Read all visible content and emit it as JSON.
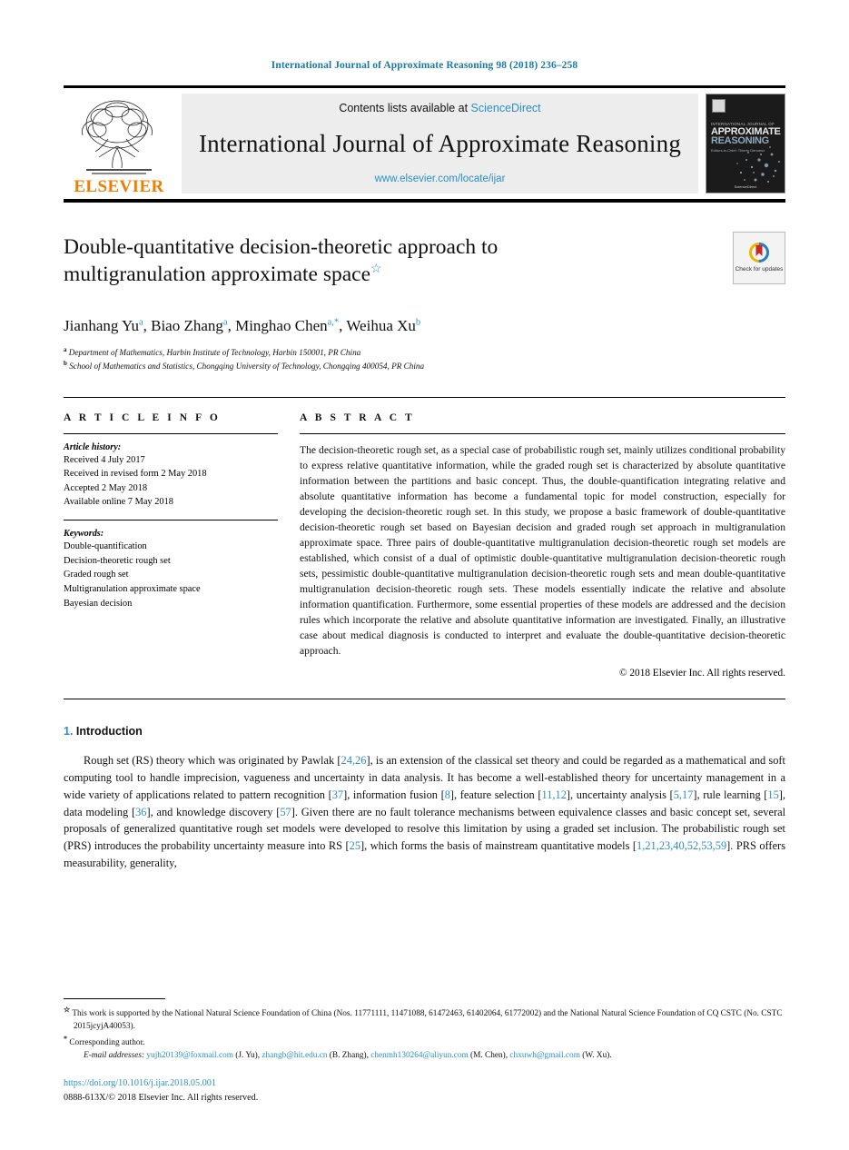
{
  "running_head": "International Journal of Approximate Reasoning 98 (2018) 236–258",
  "masthead": {
    "publisher_wordmark": "ELSEVIER",
    "contents_prefix": "Contents lists available at ",
    "contents_link": "ScienceDirect",
    "journal_title": "International Journal of Approximate Reasoning",
    "journal_url": "www.elsevier.com/locate/ijar",
    "cover": {
      "kicker": "INTERNATIONAL JOURNAL OF",
      "title_line1": "APPROXIMATE",
      "title_line2": "REASONING",
      "subtitle": "Editors-in-Chief: Thierry Denoeux",
      "footer": "ScienceDirect"
    }
  },
  "article": {
    "title": "Double-quantitative decision-theoretic approach to multigranulation approximate space",
    "title_line1": "Double-quantitative decision-theoretic approach to",
    "title_line2": "multigranulation approximate space",
    "title_footnote_mark": "☆",
    "crossmark_label": "Check for updates",
    "authors": [
      {
        "name": "Jianhang Yu",
        "marks": "a",
        "sep": ", "
      },
      {
        "name": "Biao Zhang",
        "marks": "a",
        "sep": ", "
      },
      {
        "name": "Minghao Chen",
        "marks": "a,*",
        "sep": ", "
      },
      {
        "name": "Weihua Xu",
        "marks": "b",
        "sep": ""
      }
    ],
    "affiliations": [
      {
        "mark": "a",
        "text": "Department of Mathematics, Harbin Institute of Technology, Harbin 150001, PR China"
      },
      {
        "mark": "b",
        "text": "School of Mathematics and Statistics, Chongqing University of Technology, Chongqing 400054, PR China"
      }
    ]
  },
  "article_info": {
    "label": "A R T I C L E    I N F O",
    "history_heading": "Article history:",
    "history": [
      "Received 4 July 2017",
      "Received in revised form 2 May 2018",
      "Accepted 2 May 2018",
      "Available online 7 May 2018"
    ],
    "keywords_heading": "Keywords:",
    "keywords": [
      "Double-quantification",
      "Decision-theoretic rough set",
      "Graded rough set",
      "Multigranulation approximate space",
      "Bayesian decision"
    ]
  },
  "abstract": {
    "label": "A B S T R A C T",
    "text": "The decision-theoretic rough set, as a special case of probabilistic rough set, mainly utilizes conditional probability to express relative quantitative information, while the graded rough set is characterized by absolute quantitative information between the partitions and basic concept. Thus, the double-quantification integrating relative and absolute quantitative information has become a fundamental topic for model construction, especially for developing the decision-theoretic rough set. In this study, we propose a basic framework of double-quantitative decision-theoretic rough set based on Bayesian decision and graded rough set approach in multigranulation approximate space. Three pairs of double-quantitative multigranulation decision-theoretic rough set models are established, which consist of a dual of optimistic double-quantitative multigranulation decision-theoretic rough sets, pessimistic double-quantitative multigranulation decision-theoretic rough sets and mean double-quantitative multigranulation decision-theoretic rough sets. These models essentially indicate the relative and absolute information quantification. Furthermore, some essential properties of these models are addressed and the decision rules which incorporate the relative and absolute quantitative information are investigated. Finally, an illustrative case about medical diagnosis is conducted to interpret and evaluate the double-quantitative decision-theoretic approach.",
    "copyright": "© 2018 Elsevier Inc. All rights reserved."
  },
  "introduction": {
    "number": "1.",
    "title": "Introduction",
    "paragraph_parts": [
      {
        "t": "Rough set (RS) theory which was originated by Pawlak [",
        "k": "text"
      },
      {
        "t": "24,26",
        "k": "cite"
      },
      {
        "t": "], is an extension of the classical set theory and could be regarded as a mathematical and soft computing tool to handle imprecision, vagueness and uncertainty in data analysis. It has become a well-established theory for uncertainty management in a wide variety of applications related to pattern recognition [",
        "k": "text"
      },
      {
        "t": "37",
        "k": "cite"
      },
      {
        "t": "], information fusion [",
        "k": "text"
      },
      {
        "t": "8",
        "k": "cite"
      },
      {
        "t": "], feature selection [",
        "k": "text"
      },
      {
        "t": "11,12",
        "k": "cite"
      },
      {
        "t": "], uncertainty analysis [",
        "k": "text"
      },
      {
        "t": "5,17",
        "k": "cite"
      },
      {
        "t": "], rule learning [",
        "k": "text"
      },
      {
        "t": "15",
        "k": "cite"
      },
      {
        "t": "], data modeling [",
        "k": "text"
      },
      {
        "t": "36",
        "k": "cite"
      },
      {
        "t": "], and knowledge discovery [",
        "k": "text"
      },
      {
        "t": "57",
        "k": "cite"
      },
      {
        "t": "]. Given there are no fault tolerance mechanisms between equivalence classes and basic concept set, several proposals of generalized quantitative rough set models were developed to resolve this limitation by using a graded set inclusion. The probabilistic rough set (PRS) introduces the probability uncertainty measure into RS [",
        "k": "text"
      },
      {
        "t": "25",
        "k": "cite"
      },
      {
        "t": "], which forms the basis of mainstream quantitative models [",
        "k": "text"
      },
      {
        "t": "1,21,23,40,52,53,59",
        "k": "cite"
      },
      {
        "t": "]. PRS offers measurability, generality,",
        "k": "text"
      }
    ]
  },
  "footnotes": {
    "funding_mark": "☆",
    "funding": "This work is supported by the National Natural Science Foundation of China (Nos. 11771111, 11471088, 61472463, 61402064, 61772002) and the National Natural Science Foundation of CQ CSTC (No. CSTC 2015jcyjA40053).",
    "corresponding_mark": "*",
    "corresponding": "Corresponding author.",
    "email_label": "E-mail addresses:",
    "emails": [
      {
        "address": "yujh20139@foxmail.com",
        "author": " (J. Yu), "
      },
      {
        "address": "zhangb@hit.edu.cn",
        "author": " (B. Zhang), "
      },
      {
        "address": "chenmh130264@aliyun.com",
        "author": " (M. Chen), "
      },
      {
        "address": "chxuwh@gmail.com",
        "author": " (W. Xu)."
      }
    ]
  },
  "bottom": {
    "doi": "https://doi.org/10.1016/j.ijar.2018.05.001",
    "issn_copyright": "0888-613X/© 2018 Elsevier Inc. All rights reserved."
  },
  "colors": {
    "link": "#2b8fc4",
    "running_head": "#1a7aa8",
    "elsevier_orange": "#ef7d00"
  }
}
